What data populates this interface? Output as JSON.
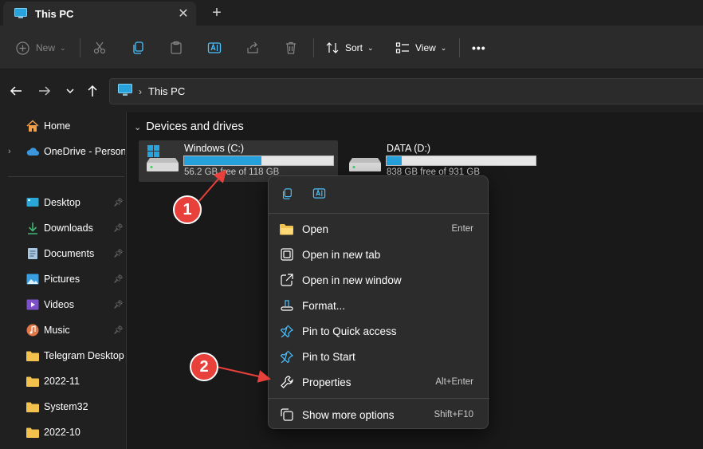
{
  "tab": {
    "title": "This PC",
    "close": "✕",
    "new_tab": "+"
  },
  "commands": {
    "new_label": "New",
    "sort_label": "Sort",
    "view_label": "View",
    "more": "•••"
  },
  "address": {
    "crumb": "This PC"
  },
  "sidebar": {
    "items": [
      {
        "label": "Home",
        "icon": "home-icon"
      },
      {
        "label": "OneDrive - Personal",
        "icon": "cloud-icon"
      },
      {
        "label": "Desktop",
        "icon": "desktop-icon",
        "pinned": true
      },
      {
        "label": "Downloads",
        "icon": "download-icon",
        "pinned": true
      },
      {
        "label": "Documents",
        "icon": "document-icon",
        "pinned": true
      },
      {
        "label": "Pictures",
        "icon": "picture-icon",
        "pinned": true
      },
      {
        "label": "Videos",
        "icon": "video-icon",
        "pinned": true
      },
      {
        "label": "Music",
        "icon": "music-icon",
        "pinned": true
      },
      {
        "label": "Telegram Desktop",
        "icon": "folder-icon"
      },
      {
        "label": "2022-11",
        "icon": "folder-icon"
      },
      {
        "label": "System32",
        "icon": "folder-icon"
      },
      {
        "label": "2022-10",
        "icon": "folder-icon"
      }
    ]
  },
  "main": {
    "group_title": "Devices and drives",
    "drives": [
      {
        "name": "Windows (C:)",
        "free_text": "56.2 GB free of 118 GB",
        "used_fraction": 0.52
      },
      {
        "name": "DATA (D:)",
        "free_text": "838 GB free of 931 GB",
        "used_fraction": 0.1
      }
    ]
  },
  "context_menu": {
    "items": [
      {
        "label": "Open",
        "key": "Enter"
      },
      {
        "label": "Open in new tab",
        "key": ""
      },
      {
        "label": "Open in new window",
        "key": ""
      },
      {
        "label": "Format...",
        "key": ""
      },
      {
        "label": "Pin to Quick access",
        "key": ""
      },
      {
        "label": "Pin to Start",
        "key": ""
      },
      {
        "label": "Properties",
        "key": "Alt+Enter"
      },
      {
        "label": "Show more options",
        "key": "Shift+F10"
      }
    ]
  },
  "annotations": {
    "badge1": "1",
    "badge2": "2"
  },
  "colors": {
    "accent": "#26a0da",
    "badge": "#e8403a",
    "folder": "#f2c14e"
  }
}
